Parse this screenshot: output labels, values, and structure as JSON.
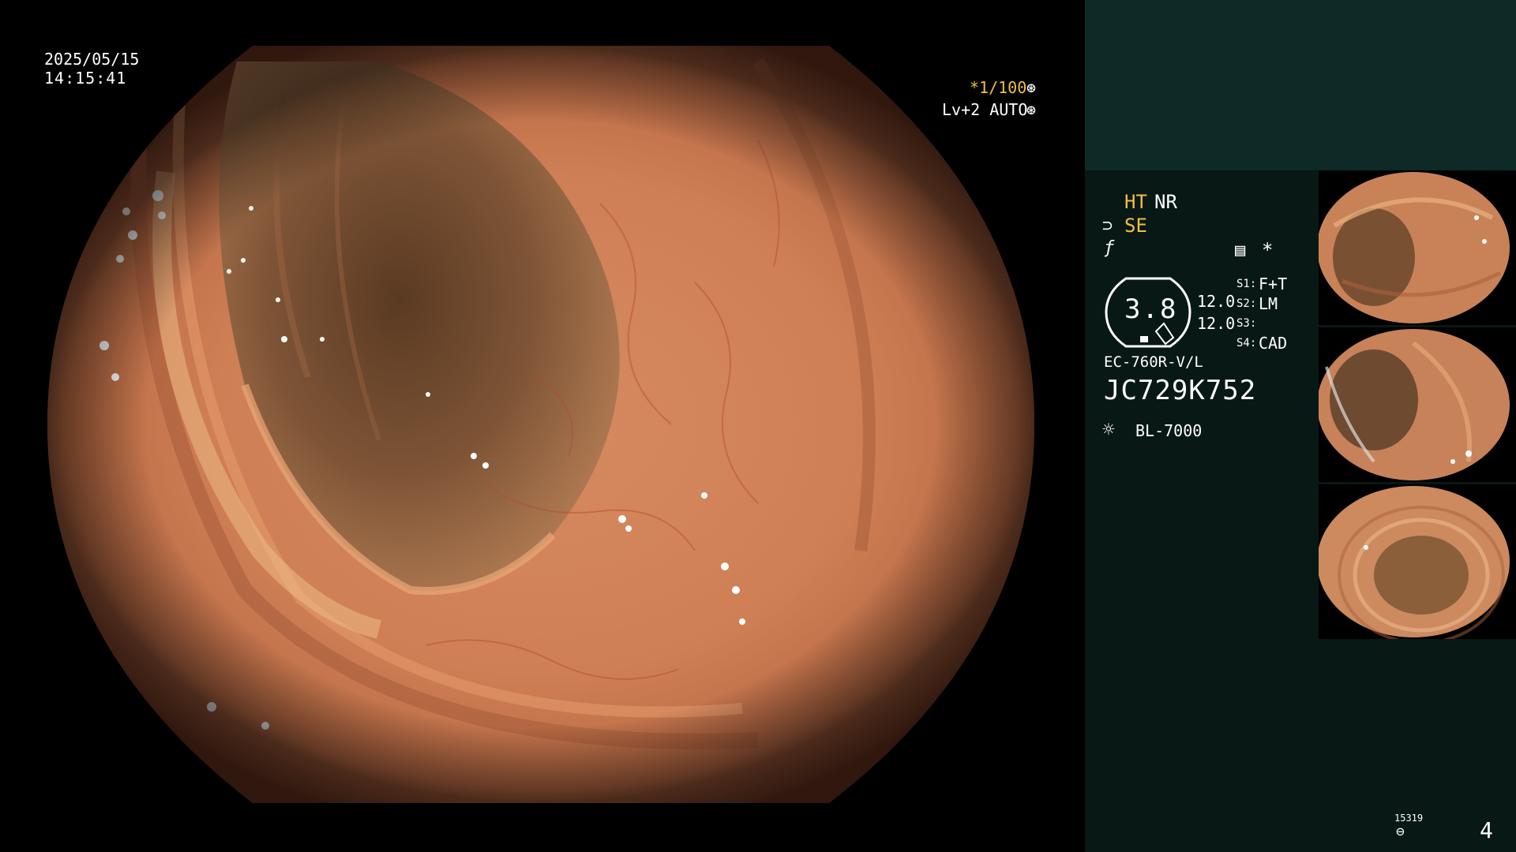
{
  "overlay": {
    "date": "2025/05/15",
    "time": "14:15:41",
    "shutter": "*1/100",
    "shutter_icon": "aperture-icon",
    "level": "Lv+2 AUTO",
    "auto_icon": "iris-icon"
  },
  "panel": {
    "ht": "HT",
    "nr": "NR",
    "se": "SE",
    "zoom": "3.8",
    "values": [
      "12.0",
      "12.0"
    ],
    "switches": [
      {
        "key": "S1:",
        "value": "F+T"
      },
      {
        "key": "S2:",
        "value": "LM"
      },
      {
        "key": "S3:",
        "value": ""
      },
      {
        "key": "S4:",
        "value": "CAD"
      }
    ],
    "scope_model": "EC-760R-V/L",
    "scope_serial": "JC729K752",
    "light_source": "BL-7000",
    "counter": "15319",
    "page_number": "4"
  },
  "colors": {
    "accent_yellow": "#f0c040",
    "panel_bg": "#081815",
    "panel_top_bg": "#0f2a26",
    "mucosa": "#c47a55"
  }
}
